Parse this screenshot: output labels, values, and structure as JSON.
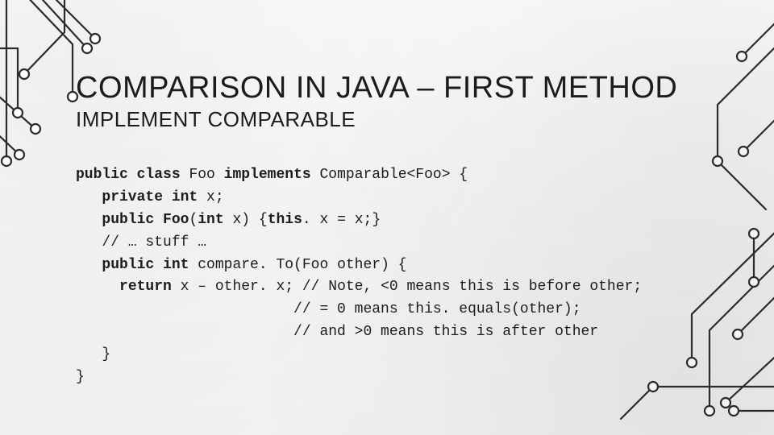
{
  "title": "COMPARISON IN JAVA – FIRST METHOD",
  "subtitle": "IMPLEMENT COMPARABLE",
  "code": {
    "lines": [
      {
        "segs": [
          {
            "t": "public class ",
            "b": true
          },
          {
            "t": "Foo ",
            "b": false
          },
          {
            "t": "implements ",
            "b": true
          },
          {
            "t": "Comparable<Foo> {",
            "b": false
          }
        ]
      },
      {
        "segs": [
          {
            "t": "   ",
            "b": false
          },
          {
            "t": "private int ",
            "b": true
          },
          {
            "t": "x;",
            "b": false
          }
        ]
      },
      {
        "segs": [
          {
            "t": "   ",
            "b": false
          },
          {
            "t": "public ",
            "b": true
          },
          {
            "t": "Foo",
            "b": true
          },
          {
            "t": "(",
            "b": false
          },
          {
            "t": "int ",
            "b": true
          },
          {
            "t": "x) {",
            "b": false
          },
          {
            "t": "this",
            "b": true
          },
          {
            "t": ". x = x;}",
            "b": false
          }
        ]
      },
      {
        "segs": [
          {
            "t": "   // … stuff …",
            "b": false
          }
        ]
      },
      {
        "segs": [
          {
            "t": "   ",
            "b": false
          },
          {
            "t": "public int ",
            "b": true
          },
          {
            "t": "compare. To(Foo other) {",
            "b": false
          }
        ]
      },
      {
        "segs": [
          {
            "t": "     ",
            "b": false
          },
          {
            "t": "return ",
            "b": true
          },
          {
            "t": "x – other. x; // Note, <0 means this is before other;",
            "b": false
          }
        ]
      },
      {
        "segs": [
          {
            "t": "                         // = 0 means this. equals(other);",
            "b": false
          }
        ]
      },
      {
        "segs": [
          {
            "t": "                         // and >0 means this is after other",
            "b": false
          }
        ]
      },
      {
        "segs": [
          {
            "t": "   }",
            "b": false
          }
        ]
      },
      {
        "segs": [
          {
            "t": "}",
            "b": false
          }
        ]
      }
    ]
  }
}
